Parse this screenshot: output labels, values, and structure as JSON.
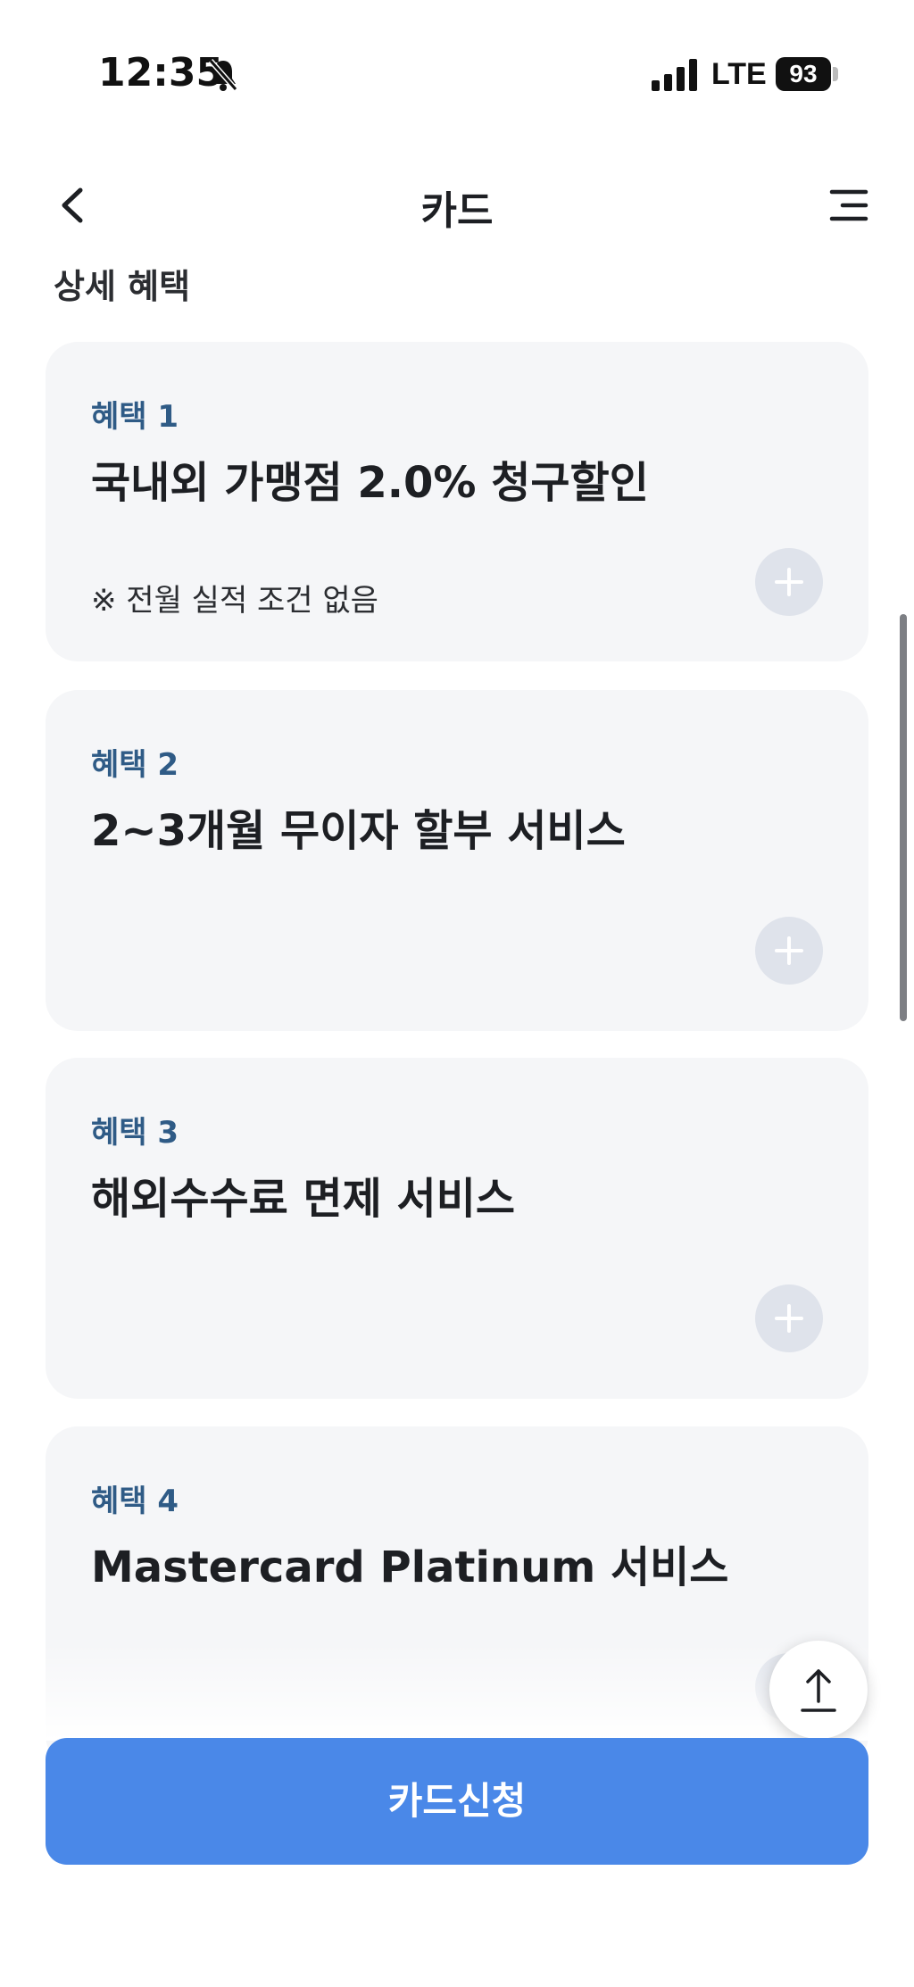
{
  "status_bar": {
    "time": "12:35",
    "network": "LTE",
    "battery": "93"
  },
  "header": {
    "title": "카드"
  },
  "section": {
    "title": "상세 혜택"
  },
  "benefits": [
    {
      "label": "혜택 1",
      "title": "국내외 가맹점 2.0% 청구할인",
      "note": "※ 전월 실적 조건 없음"
    },
    {
      "label": "혜택 2",
      "title": "2~3개월 무이자 할부 서비스"
    },
    {
      "label": "혜택 3",
      "title": "해외수수료 면제 서비스"
    },
    {
      "label": "혜택 4",
      "title": "Mastercard Platinum 서비스"
    }
  ],
  "cta": {
    "label": "카드신청"
  },
  "colors": {
    "accent": "#4a88e8",
    "label_blue": "#2f5b86",
    "card_bg": "#f5f6f8"
  }
}
